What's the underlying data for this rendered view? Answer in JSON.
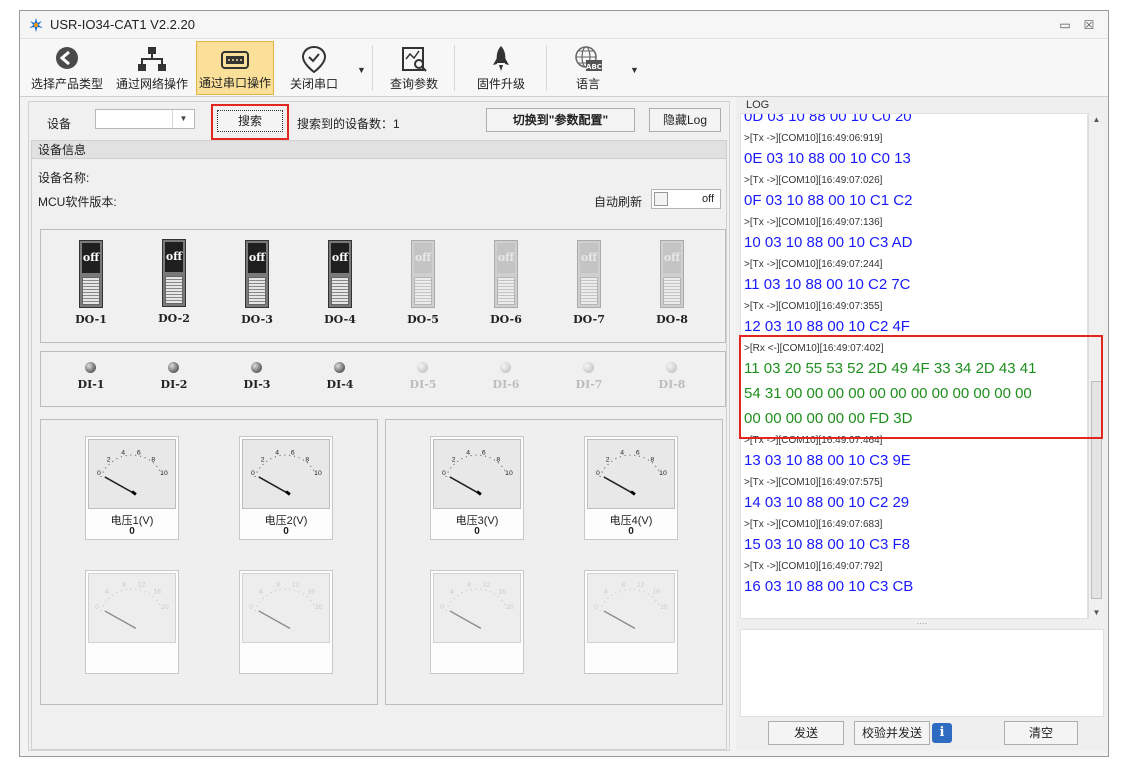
{
  "window": {
    "title": "USR-IO34-CAT1 V2.2.20"
  },
  "toolbar": {
    "items": [
      {
        "label": "选择产品类型"
      },
      {
        "label": "通过网络操作"
      },
      {
        "label": "通过串口操作"
      },
      {
        "label": "关闭串口"
      },
      {
        "label": "查询参数"
      },
      {
        "label": "固件升级"
      },
      {
        "label": "语言"
      }
    ],
    "active_index": 2
  },
  "device_bar": {
    "device_label": "设备",
    "device_value": "",
    "search_button": "搜索",
    "found_text": "搜索到的设备数：1",
    "switch_button": "切换到\"参数配置\"",
    "hide_log_button": "隐藏Log"
  },
  "device_info": {
    "header": "设备信息",
    "name_label": "设备名称:",
    "mcu_label": "MCU软件版本:",
    "auto_refresh_label": "自动刷新",
    "auto_refresh_state": "off"
  },
  "digital_outputs": [
    {
      "label": "DO-1",
      "state": "off",
      "enabled": true
    },
    {
      "label": "DO-2",
      "state": "off",
      "enabled": true
    },
    {
      "label": "DO-3",
      "state": "off",
      "enabled": true
    },
    {
      "label": "DO-4",
      "state": "off",
      "enabled": true
    },
    {
      "label": "DO-5",
      "state": "off",
      "enabled": false
    },
    {
      "label": "DO-6",
      "state": "off",
      "enabled": false
    },
    {
      "label": "DO-7",
      "state": "off",
      "enabled": false
    },
    {
      "label": "DO-8",
      "state": "off",
      "enabled": false
    }
  ],
  "digital_inputs": [
    {
      "label": "DI-1",
      "enabled": true
    },
    {
      "label": "DI-2",
      "enabled": true
    },
    {
      "label": "DI-3",
      "enabled": true
    },
    {
      "label": "DI-4",
      "enabled": true
    },
    {
      "label": "DI-5",
      "enabled": false
    },
    {
      "label": "DI-6",
      "enabled": false
    },
    {
      "label": "DI-7",
      "enabled": false
    },
    {
      "label": "DI-8",
      "enabled": false
    }
  ],
  "meters": {
    "scale_ticks": [
      "0",
      "2",
      "4",
      "6",
      "8",
      "10"
    ],
    "disabled_scale_ticks": [
      "0",
      "4",
      "8",
      "12",
      "16",
      "20"
    ],
    "items": [
      {
        "name": "电压1(V)",
        "value": "0"
      },
      {
        "name": "电压2(V)",
        "value": "0"
      },
      {
        "name": "电压3(V)",
        "value": "0"
      },
      {
        "name": "电压4(V)",
        "value": "0"
      }
    ]
  },
  "log": {
    "title": "LOG",
    "lines": [
      {
        "type": "tx",
        "text": "0D 03 10 88 00 10 C0 20"
      },
      {
        "type": "meta",
        "text": ">[Tx ->][COM10][16:49:06:919]"
      },
      {
        "type": "tx",
        "text": "0E 03 10 88 00 10 C0 13"
      },
      {
        "type": "meta",
        "text": ">[Tx ->][COM10][16:49:07:026]"
      },
      {
        "type": "tx",
        "text": "0F 03 10 88 00 10 C1 C2"
      },
      {
        "type": "meta",
        "text": ">[Tx ->][COM10][16:49:07:136]"
      },
      {
        "type": "tx",
        "text": "10 03 10 88 00 10 C3 AD"
      },
      {
        "type": "meta",
        "text": ">[Tx ->][COM10][16:49:07:244]"
      },
      {
        "type": "tx",
        "text": "11 03 10 88 00 10 C2 7C"
      },
      {
        "type": "meta",
        "text": ">[Tx ->][COM10][16:49:07:355]"
      },
      {
        "type": "tx",
        "text": "12 03 10 88 00 10 C2 4F"
      },
      {
        "type": "meta",
        "text": ">[Rx <-][COM10][16:49:07:402]"
      },
      {
        "type": "rx",
        "text": "11 03 20 55 53 52 2D 49 4F 33 34 2D 43 41"
      },
      {
        "type": "rx",
        "text": "54 31 00 00 00 00 00 00 00 00 00 00 00 00"
      },
      {
        "type": "rx",
        "text": "00 00 00 00 00 00 FD 3D"
      },
      {
        "type": "meta",
        "text": ">[Tx ->][COM10][16:49:07:464]"
      },
      {
        "type": "tx",
        "text": "13 03 10 88 00 10 C3 9E"
      },
      {
        "type": "meta",
        "text": ">[Tx ->][COM10][16:49:07:575]"
      },
      {
        "type": "tx",
        "text": "14 03 10 88 00 10 C2 29"
      },
      {
        "type": "meta",
        "text": ">[Tx ->][COM10][16:49:07:683]"
      },
      {
        "type": "tx",
        "text": "15 03 10 88 00 10 C3 F8"
      },
      {
        "type": "meta",
        "text": ">[Tx ->][COM10][16:49:07:792]"
      },
      {
        "type": "tx",
        "text": "16 03 10 88 00 10 C3 CB"
      }
    ],
    "send_button": "发送",
    "verify_send_button": "校验并发送",
    "clear_button": "清空",
    "colors": {
      "tx": "#1a1aff",
      "rx": "#1e8f1e",
      "highlight": "#e0261f"
    }
  }
}
